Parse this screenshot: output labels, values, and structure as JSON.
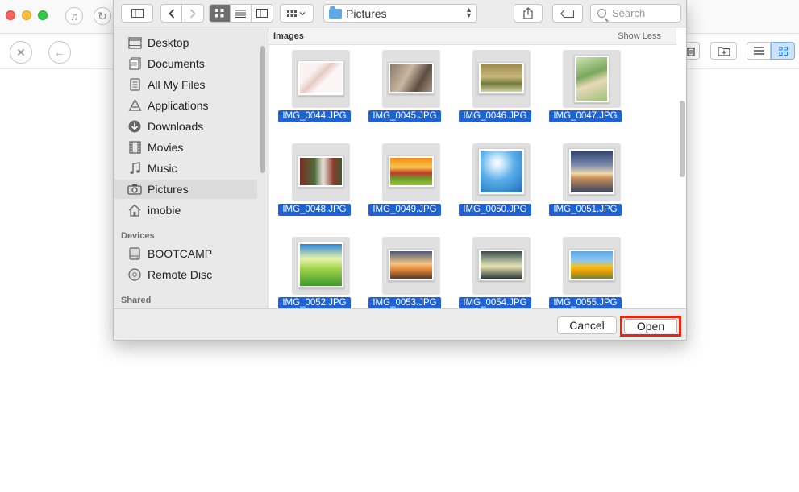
{
  "dialog": {
    "path": "Pictures",
    "search_placeholder": "Search",
    "section_label": "Images",
    "show_less": "Show Less",
    "cancel_label": "Cancel",
    "open_label": "Open"
  },
  "sidebar": {
    "favorites": [
      {
        "label": "Desktop",
        "icon": "desktop-icon"
      },
      {
        "label": "Documents",
        "icon": "documents-icon"
      },
      {
        "label": "All My Files",
        "icon": "all-files-icon"
      },
      {
        "label": "Applications",
        "icon": "applications-icon"
      },
      {
        "label": "Downloads",
        "icon": "downloads-icon"
      },
      {
        "label": "Movies",
        "icon": "movies-icon"
      },
      {
        "label": "Music",
        "icon": "music-icon"
      },
      {
        "label": "Pictures",
        "icon": "camera-icon",
        "selected": true
      },
      {
        "label": "imobie",
        "icon": "home-icon"
      }
    ],
    "devices_heading": "Devices",
    "devices": [
      {
        "label": "BOOTCAMP",
        "icon": "drive-icon"
      },
      {
        "label": "Remote Disc",
        "icon": "disc-icon"
      }
    ],
    "shared_heading": "Shared"
  },
  "files": [
    {
      "name": "IMG_0044.JPG"
    },
    {
      "name": "IMG_0045.JPG"
    },
    {
      "name": "IMG_0046.JPG"
    },
    {
      "name": "IMG_0047.JPG"
    },
    {
      "name": "IMG_0048.JPG"
    },
    {
      "name": "IMG_0049.JPG"
    },
    {
      "name": "IMG_0050.JPG"
    },
    {
      "name": "IMG_0051.JPG"
    },
    {
      "name": "IMG_0052.JPG"
    },
    {
      "name": "IMG_0053.JPG"
    },
    {
      "name": "IMG_0054.JPG"
    },
    {
      "name": "IMG_0055.JPG"
    }
  ],
  "colors": {
    "selection": "#1d63d6",
    "highlight": "#e8260f"
  }
}
